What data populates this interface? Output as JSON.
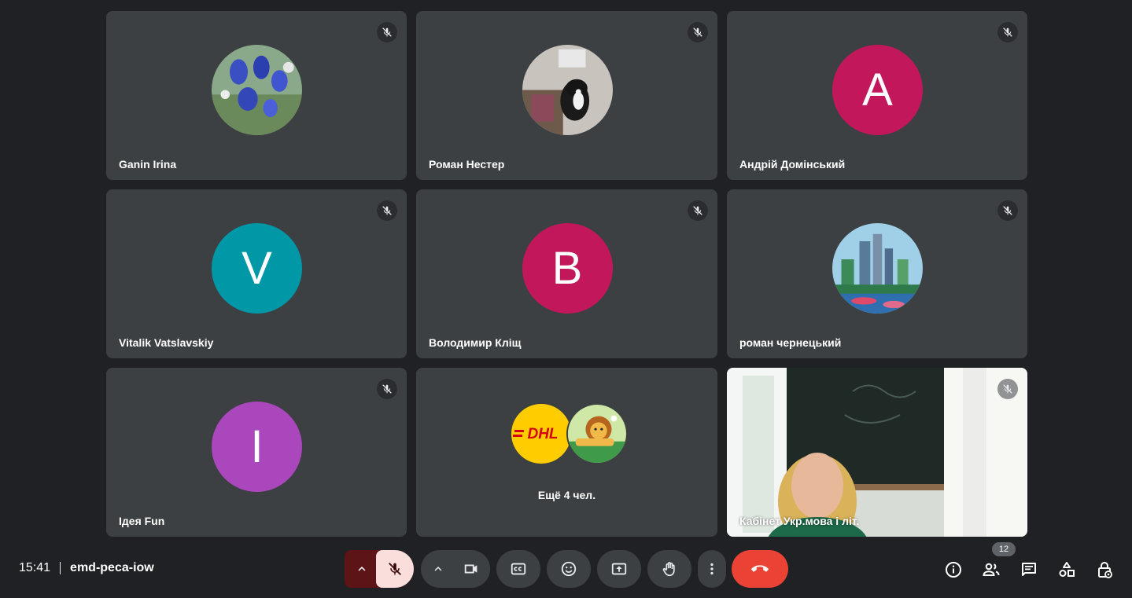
{
  "participants": [
    {
      "name": "Ganin Irina",
      "avatar_type": "photo-flowers"
    },
    {
      "name": "Роман Нестер",
      "avatar_type": "photo-cat"
    },
    {
      "name": "Андрій Домінський",
      "avatar_type": "initial",
      "initial": "A",
      "color": "#c2185b"
    },
    {
      "name": "Vitalik Vatslavskiy",
      "avatar_type": "initial",
      "initial": "V",
      "color": "#0097a7"
    },
    {
      "name": "Володимир Кліщ",
      "avatar_type": "initial",
      "initial": "B",
      "color": "#c2185b"
    },
    {
      "name": "роман чернецький",
      "avatar_type": "photo-city"
    },
    {
      "name": "Ідея Fun",
      "avatar_type": "initial",
      "initial": "I",
      "color": "#ab47bc"
    }
  ],
  "more_tile": {
    "label": "Ещё 4 чел.",
    "logo_text": "DHL"
  },
  "self_tile": {
    "name": "Кабінет Укр.мова і літ."
  },
  "meeting": {
    "time": "15:41",
    "code": "emd-peca-iow"
  },
  "people_count": "12",
  "colors": {
    "background": "#202124",
    "tile": "#3c4043",
    "end_call": "#ea4335",
    "mic_off_bg": "#f9dedc",
    "mic_group_bg": "#5c1416"
  },
  "icons": [
    "mic-off-icon",
    "chevron-up-icon",
    "camera-icon",
    "captions-icon",
    "emoji-icon",
    "present-icon",
    "raise-hand-icon",
    "more-vert-icon",
    "end-call-icon",
    "info-icon",
    "people-icon",
    "chat-icon",
    "activities-icon",
    "host-controls-icon"
  ]
}
